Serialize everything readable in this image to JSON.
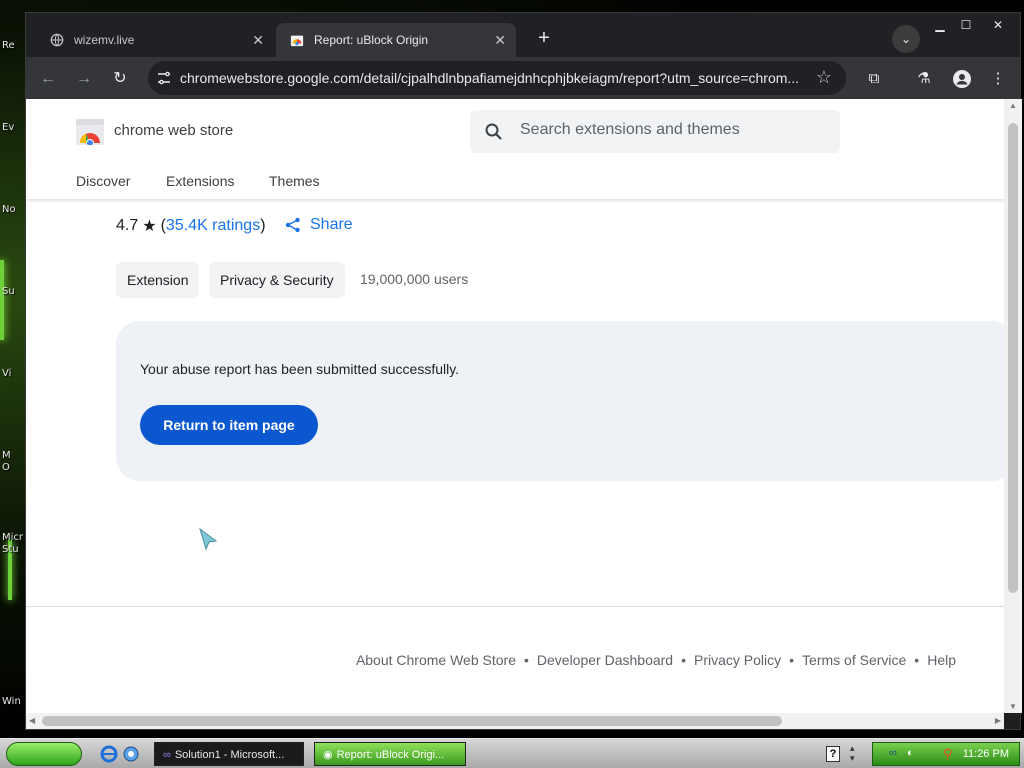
{
  "desktop": {
    "labels": [
      "Re",
      "Ev",
      "No",
      "Su",
      "Vi",
      "M\nO",
      "Micr\nStu",
      "Win"
    ]
  },
  "browser": {
    "tabs": [
      {
        "title": "wizemv.live",
        "icon": "globe-icon",
        "active": false
      },
      {
        "title": "Report: uBlock Origin",
        "icon": "chrome-web-store-icon",
        "active": true
      }
    ],
    "url": "chromewebstore.google.com/detail/cjpalhdlnbpafiamejdnhcphjbkeiagm/report?utm_source=chrom..."
  },
  "store": {
    "brand": "chrome web store",
    "search_placeholder": "Search extensions and themes",
    "nav": [
      "Discover",
      "Extensions",
      "Themes"
    ]
  },
  "item": {
    "rating": "4.7",
    "rating_count": "35.4K ratings",
    "share_label": "Share",
    "chips": [
      "Extension",
      "Privacy & Security"
    ],
    "users": "19,000,000 users"
  },
  "report": {
    "message": "Your abuse report has been submitted successfully.",
    "return_label": "Return to item page"
  },
  "footer": {
    "links": [
      "About Chrome Web Store",
      "Developer Dashboard",
      "Privacy Policy",
      "Terms of Service",
      "Help"
    ]
  },
  "taskbar": {
    "tasks": [
      "Solution1 - Microsoft...",
      "Report: uBlock Origi..."
    ],
    "clock": "11:26 PM",
    "help": "?"
  },
  "colors": {
    "link_blue": "#1a73e8",
    "primary_button": "#0b57d0",
    "report_card_bg": "#eef2f7"
  }
}
